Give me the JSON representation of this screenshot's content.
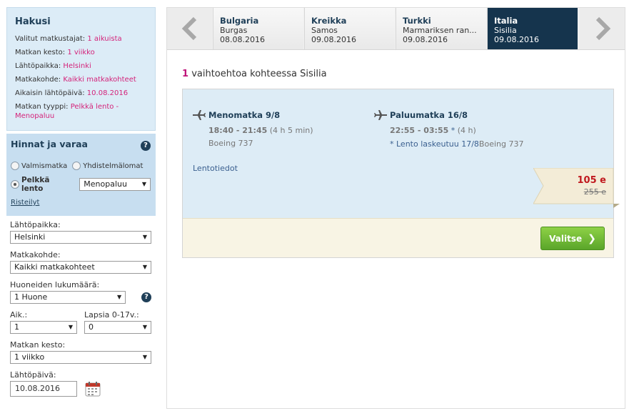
{
  "sidebar": {
    "search_title": "Hakusi",
    "summary": [
      {
        "label": "Valitut matkustajat:",
        "value": "1 aikuista"
      },
      {
        "label": "Matkan kesto:",
        "value": "1 viikko"
      },
      {
        "label": "Lähtöpaikka:",
        "value": "Helsinki"
      },
      {
        "label": "Matkakohde:",
        "value": "Kaikki matkakohteet"
      },
      {
        "label": "Aikaisin lähtöpäivä:",
        "value": "10.08.2016"
      },
      {
        "label": "Matkan tyyppi:",
        "value": "Pelkkä lento -",
        "value2": "Menopaluu"
      }
    ],
    "prices_title": "Hinnat ja varaa",
    "help_glyph": "?",
    "radio_package": "Valmismatka",
    "radio_combo": "Yhdistelmälomat",
    "radio_flight": "Pelkkä lento",
    "flight_type_select": "Menopaluu",
    "cruises_link": "Risteilyt",
    "departure_label": "Lähtöpaikka:",
    "departure_value": "Helsinki",
    "destination_label": "Matkakohde:",
    "destination_value": "Kaikki matkakohteet",
    "rooms_label": "Huoneiden lukumäärä:",
    "rooms_value": "1 Huone",
    "adults_label": "Aik.:",
    "adults_value": "1",
    "children_label": "Lapsia 0-17v.:",
    "children_value": "0",
    "duration_label": "Matkan kesto:",
    "duration_value": "1 viikko",
    "date_label": "Lähtöpäivä:",
    "date_value": "10.08.2016"
  },
  "tabs": [
    {
      "country": "Bulgaria",
      "place": "Burgas",
      "date": "08.08.2016",
      "active": false
    },
    {
      "country": "Kreikka",
      "place": "Samos",
      "date": "09.08.2016",
      "active": false
    },
    {
      "country": "Turkki",
      "place": "Marmariksen ran...",
      "date": "09.08.2016",
      "active": false
    },
    {
      "country": "Italia",
      "place": "Sisilia",
      "date": "09.08.2016",
      "active": true
    }
  ],
  "result": {
    "count": "1",
    "text": "vaihtoehtoa kohteessa Sisilia"
  },
  "outbound": {
    "title": "Menomatka 9/8",
    "time": "18:40 - 21:45",
    "duration": "(4 h 5 min)",
    "aircraft": "Boeing 737"
  },
  "return": {
    "title": "Paluumatka 16/8",
    "time": "22:55 - 03:55",
    "star": "*",
    "duration": "(4 h)",
    "note": "* Lento laskeutuu 17/8",
    "aircraft": "Boeing 737"
  },
  "flight_info_link": "Lentotiedot",
  "price": {
    "now": "105 e",
    "old": "255 e"
  },
  "choose_button": "Valitse",
  "colors": {
    "accent": "#c0157a",
    "navy": "#15344d",
    "green": "#6bb534",
    "price_red": "#c0191e"
  }
}
